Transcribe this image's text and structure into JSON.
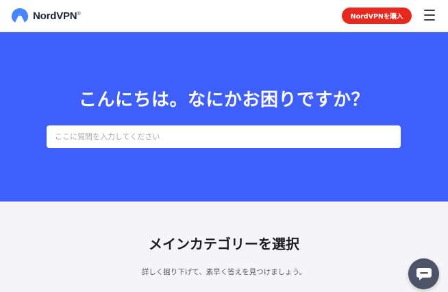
{
  "header": {
    "logo_text": "NordVPN",
    "logo_mark": "®",
    "buy_label": "NordVPNを購入",
    "menu_icon": "hamburger-menu-icon"
  },
  "hero": {
    "title": "こんにちは。なにかお困りですか？",
    "search_placeholder": "ここに質問を入力してください"
  },
  "categories": {
    "title": "メインカテゴリーを選択",
    "subtitle": "詳しく掘り下げて、素早く答えを見つけましょう。"
  },
  "chat": {
    "icon": "chat-bubble-icon"
  },
  "colors": {
    "brand_blue": "#3e5ffc",
    "buy_red": "#e8281e",
    "chat_bg": "#4d5468",
    "section_bg": "#f5f5f7"
  }
}
